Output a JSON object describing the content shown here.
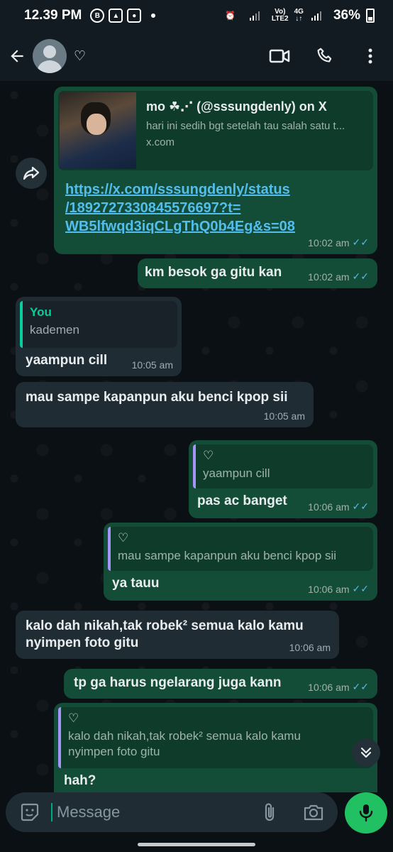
{
  "status_bar": {
    "time": "12.39 PM",
    "icons": [
      "b-icon",
      "gallery-icon",
      "instagram-icon",
      "dot"
    ],
    "network_left": "Vo)",
    "network_left2": "LTE2",
    "network_4g": "4G",
    "battery": "36%"
  },
  "header": {
    "contact_name": "♡",
    "actions": [
      "video-call-icon",
      "voice-call-icon",
      "more-icon"
    ]
  },
  "messages": [
    {
      "id": "link",
      "direction": "out",
      "link_title": "mo ☘︎⋰ (@sssungdenly) on X",
      "link_desc": "hari ini sedih bgt setelah tau salah satu t...",
      "link_domain": "x.com",
      "url_line1": "https://x.com/sssungdenly/status",
      "url_line2": "/1892727330845576697?t=",
      "url_line3": "WB5lfwqd3iqCLgThQ0b4Eg&s=08",
      "time": "10:02 am",
      "status": "read"
    },
    {
      "id": "m2",
      "direction": "out",
      "text": "km besok ga gitu kan",
      "time": "10:02 am",
      "status": "read"
    },
    {
      "id": "m3",
      "direction": "in",
      "quote_author": "You",
      "quote_text": "kademen",
      "text": "yaampun cill",
      "time": "10:05 am"
    },
    {
      "id": "m4",
      "direction": "in",
      "text": "mau sampe kapanpun aku benci kpop sii",
      "time": "10:05 am"
    },
    {
      "id": "m5",
      "direction": "out",
      "quote_author": "♡",
      "quote_text": "yaampun cill",
      "text": "pas ac banget",
      "time": "10:06 am",
      "status": "read"
    },
    {
      "id": "m6",
      "direction": "out",
      "quote_author": "♡",
      "quote_text": "mau sampe kapanpun aku benci kpop sii",
      "text": "ya tauu",
      "time": "10:06 am",
      "status": "read"
    },
    {
      "id": "m7",
      "direction": "in",
      "text_line1": "kalo dah nikah,tak robek² semua kalo kamu",
      "text_line2": "nyimpen foto gitu",
      "time": "10:06 am"
    },
    {
      "id": "m8",
      "direction": "out",
      "text": "tp ga harus ngelarang juga kann",
      "time": "10:06 am",
      "status": "read"
    },
    {
      "id": "m9",
      "direction": "out",
      "quote_author": "♡",
      "quote_line1": "kalo dah nikah,tak robek² semua kalo kamu",
      "quote_line2": "nyimpen foto gitu",
      "text": "hah?"
    }
  ],
  "input": {
    "placeholder": "Message",
    "icons": [
      "sticker-icon",
      "attach-icon",
      "camera-icon",
      "mic-icon"
    ]
  },
  "colors": {
    "outgoing_bubble": "#144d37",
    "incoming_bubble": "#202c33",
    "accent_green": "#21c063",
    "link_blue": "#53bdeb",
    "quote_green": "#06cf9c",
    "quote_purple": "#a594f9"
  }
}
